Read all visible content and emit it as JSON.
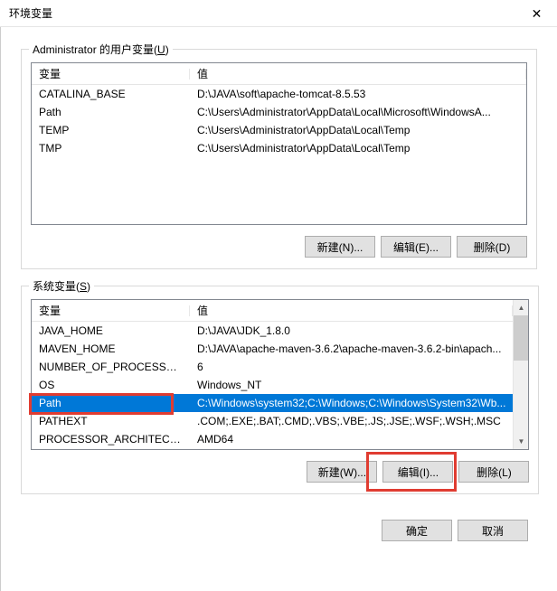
{
  "window": {
    "title": "环境变量",
    "close_glyph": "✕"
  },
  "user_section": {
    "legend_prefix": "Administrator 的用户变量(",
    "legend_accel": "U",
    "legend_suffix": ")",
    "header_var": "变量",
    "header_val": "值",
    "rows": [
      {
        "var": "CATALINA_BASE",
        "val": "D:\\JAVA\\soft\\apache-tomcat-8.5.53"
      },
      {
        "var": "Path",
        "val": "C:\\Users\\Administrator\\AppData\\Local\\Microsoft\\WindowsA..."
      },
      {
        "var": "TEMP",
        "val": "C:\\Users\\Administrator\\AppData\\Local\\Temp"
      },
      {
        "var": "TMP",
        "val": "C:\\Users\\Administrator\\AppData\\Local\\Temp"
      }
    ],
    "buttons": {
      "new": "新建(N)...",
      "edit": "编辑(E)...",
      "delete": "删除(D)"
    }
  },
  "system_section": {
    "legend_prefix": "系统变量(",
    "legend_accel": "S",
    "legend_suffix": ")",
    "header_var": "变量",
    "header_val": "值",
    "rows": [
      {
        "var": "JAVA_HOME",
        "val": "D:\\JAVA\\JDK_1.8.0"
      },
      {
        "var": "MAVEN_HOME",
        "val": "D:\\JAVA\\apache-maven-3.6.2\\apache-maven-3.6.2-bin\\apach..."
      },
      {
        "var": "NUMBER_OF_PROCESSORS",
        "val": "6"
      },
      {
        "var": "OS",
        "val": "Windows_NT"
      },
      {
        "var": "Path",
        "val": "C:\\Windows\\system32;C:\\Windows;C:\\Windows\\System32\\Wb...",
        "selected": true
      },
      {
        "var": "PATHEXT",
        "val": ".COM;.EXE;.BAT;.CMD;.VBS;.VBE;.JS;.JSE;.WSF;.WSH;.MSC"
      },
      {
        "var": "PROCESSOR_ARCHITECT...",
        "val": "AMD64"
      }
    ],
    "buttons": {
      "new": "新建(W)...",
      "edit": "编辑(I)...",
      "delete": "删除(L)"
    }
  },
  "dialog_buttons": {
    "ok": "确定",
    "cancel": "取消"
  },
  "scroll": {
    "up": "▲",
    "down": "▼"
  }
}
